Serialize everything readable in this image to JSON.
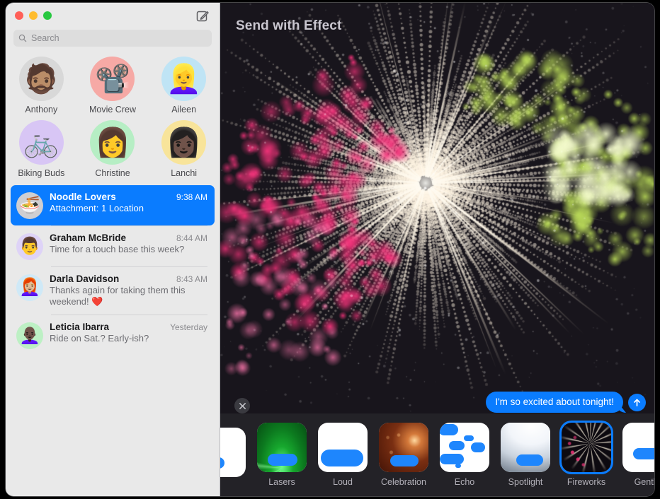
{
  "window": {
    "traffic_lights": [
      "close",
      "minimize",
      "zoom"
    ],
    "compose_icon": "compose-pencil-icon"
  },
  "sidebar": {
    "search": {
      "placeholder": "Search",
      "value": "",
      "icon": "search-icon"
    },
    "pinned": [
      {
        "name": "Anthony",
        "emoji": "🧔🏽",
        "bg": "#d8d8d8"
      },
      {
        "name": "Movie Crew",
        "emoji": "📽️",
        "bg": "#f6a9a5"
      },
      {
        "name": "Aileen",
        "emoji": "👱‍♀️",
        "bg": "#bfe4f5"
      },
      {
        "name": "Biking Buds",
        "emoji": "🚲",
        "bg": "#d8c6f5"
      },
      {
        "name": "Christine",
        "emoji": "👩",
        "bg": "#b6eec4"
      },
      {
        "name": "Lanchi",
        "emoji": "👩🏿",
        "bg": "#f8e49a"
      }
    ],
    "conversations": [
      {
        "name": "Noodle Lovers",
        "preview": "Attachment: 1 Location",
        "time": "9:38 AM",
        "emoji": "🍜",
        "bg": "#cfcfd2",
        "selected": true
      },
      {
        "name": "Graham McBride",
        "preview": "Time for a touch base this week?",
        "time": "8:44 AM",
        "emoji": "👨",
        "bg": "#ded3f7",
        "selected": false
      },
      {
        "name": "Darla Davidson",
        "preview": "Thanks again for taking them this weekend! ❤️",
        "time": "8:43 AM",
        "emoji": "👩🏼‍🦰",
        "bg": "#cfe9f7",
        "selected": false
      },
      {
        "name": "Leticia Ibarra",
        "preview": "Ride on Sat.? Early-ish?",
        "time": "Yesterday",
        "emoji": "👩🏿‍🦲",
        "bg": "#bdf0c4",
        "selected": false
      }
    ]
  },
  "main": {
    "title": "Send with Effect",
    "close_icon": "close-x-icon",
    "message": {
      "text": "I'm so excited about tonight!",
      "send_icon": "send-arrow-up-icon"
    },
    "effects": [
      {
        "label": "",
        "style": "clipped",
        "selected": false
      },
      {
        "label": "Lasers",
        "style": "lasers",
        "selected": false
      },
      {
        "label": "Loud",
        "style": "loud",
        "selected": false
      },
      {
        "label": "Celebration",
        "style": "celebration",
        "selected": false
      },
      {
        "label": "Echo",
        "style": "echo",
        "selected": false
      },
      {
        "label": "Spotlight",
        "style": "spotlight",
        "selected": false
      },
      {
        "label": "Fireworks",
        "style": "fireworks",
        "selected": true
      },
      {
        "label": "Gentle",
        "style": "gentle",
        "selected": false
      }
    ]
  },
  "colors": {
    "accent_blue": "#0a7cff",
    "sidebar_bg": "#e9e9e9",
    "main_bg": "#1a171e",
    "tray_bg": "#232227",
    "firework_white": "#fff4e4",
    "firework_pink": "#f2337a",
    "firework_green": "#b8d858"
  }
}
